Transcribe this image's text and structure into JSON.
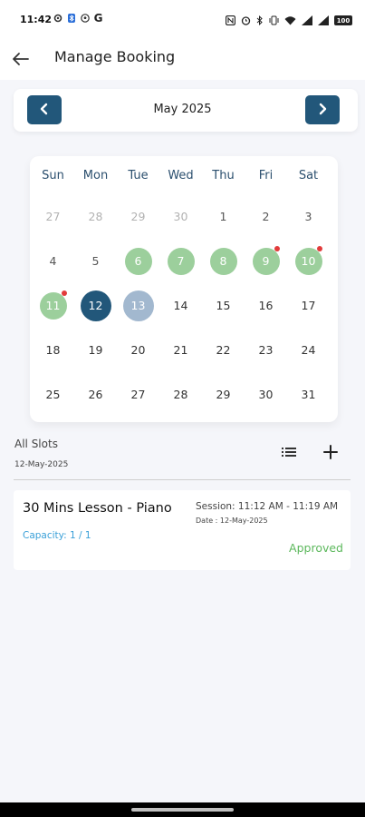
{
  "status_bar": {
    "time": "11:42",
    "left_icons": [
      "settings-gear-icon",
      "bluetooth-icon",
      "soccer-ball-icon"
    ],
    "g_label": "G",
    "right_icons": [
      "nfc-icon",
      "alarm-icon",
      "bluetooth-icon",
      "vibrate-icon",
      "wifi-icon",
      "signal-icon",
      "signal-icon"
    ],
    "battery": "100"
  },
  "header": {
    "title": "Manage Booking"
  },
  "calendar": {
    "month_label": "May 2025",
    "weekdays": [
      "Sun",
      "Mon",
      "Tue",
      "Wed",
      "Thu",
      "Fri",
      "Sat"
    ],
    "weeks": [
      [
        {
          "d": "27",
          "state": "muted"
        },
        {
          "d": "28",
          "state": "muted"
        },
        {
          "d": "29",
          "state": "muted"
        },
        {
          "d": "30",
          "state": "muted"
        },
        {
          "d": "1",
          "state": "past"
        },
        {
          "d": "2",
          "state": "past"
        },
        {
          "d": "3",
          "state": "past"
        }
      ],
      [
        {
          "d": "4",
          "state": "past"
        },
        {
          "d": "5",
          "state": "past"
        },
        {
          "d": "6",
          "state": "green"
        },
        {
          "d": "7",
          "state": "green"
        },
        {
          "d": "8",
          "state": "green"
        },
        {
          "d": "9",
          "state": "green",
          "dot": true
        },
        {
          "d": "10",
          "state": "green",
          "dot": true
        }
      ],
      [
        {
          "d": "11",
          "state": "green",
          "dot": true
        },
        {
          "d": "12",
          "state": "selected"
        },
        {
          "d": "13",
          "state": "today"
        },
        {
          "d": "14",
          "state": "normal"
        },
        {
          "d": "15",
          "state": "normal"
        },
        {
          "d": "16",
          "state": "normal"
        },
        {
          "d": "17",
          "state": "normal"
        }
      ],
      [
        {
          "d": "18",
          "state": "normal"
        },
        {
          "d": "19",
          "state": "normal"
        },
        {
          "d": "20",
          "state": "normal"
        },
        {
          "d": "21",
          "state": "normal"
        },
        {
          "d": "22",
          "state": "normal"
        },
        {
          "d": "23",
          "state": "normal"
        },
        {
          "d": "24",
          "state": "normal"
        }
      ],
      [
        {
          "d": "25",
          "state": "normal"
        },
        {
          "d": "26",
          "state": "normal"
        },
        {
          "d": "27",
          "state": "normal"
        },
        {
          "d": "28",
          "state": "normal"
        },
        {
          "d": "29",
          "state": "normal"
        },
        {
          "d": "30",
          "state": "normal"
        },
        {
          "d": "31",
          "state": "normal"
        }
      ]
    ]
  },
  "slots": {
    "title": "All Slots",
    "date": "12-May-2025"
  },
  "lesson": {
    "name": "30 Mins Lesson - Piano",
    "capacity": "Capacity: 1 / 1",
    "session": "Session: 11:12 AM - 11:19 AM",
    "date": "Date : 12-May-2025",
    "status": "Approved"
  },
  "colors": {
    "accent": "#22577a",
    "available": "#9ccf9c",
    "today": "#a2b8cf",
    "dot": "#e23b3b",
    "approved": "#5cb85c",
    "capacity": "#3aa0d8"
  }
}
